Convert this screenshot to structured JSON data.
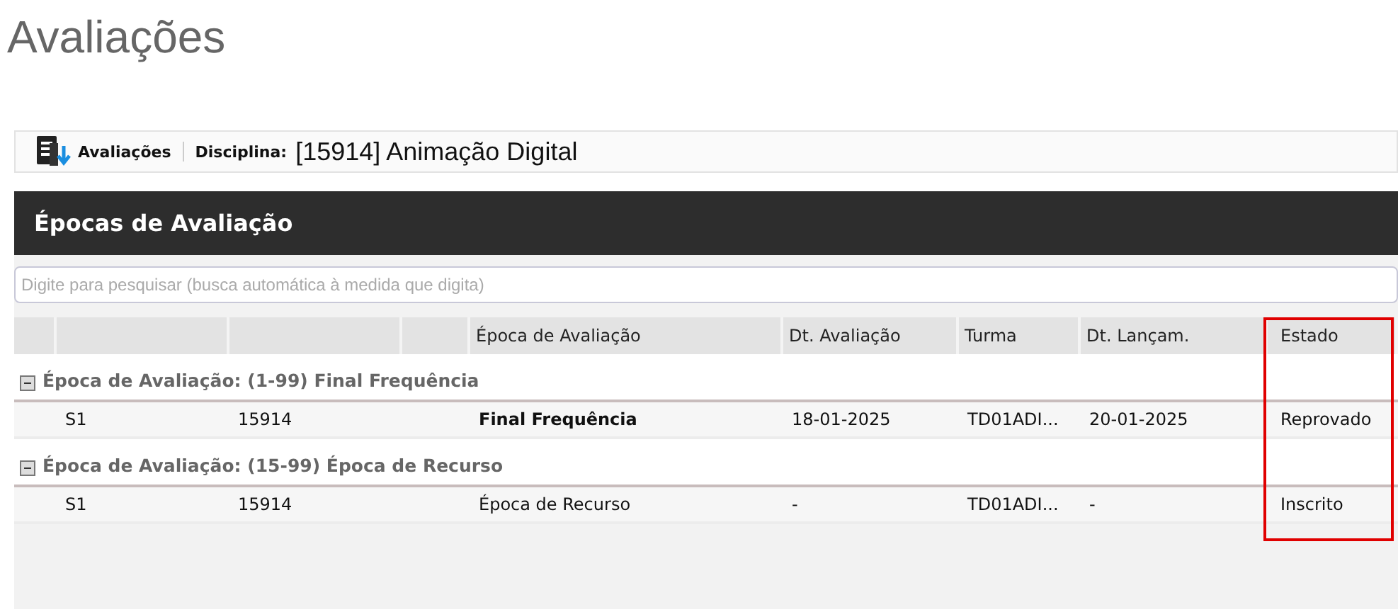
{
  "page_title": "Avaliações",
  "toolbar": {
    "button": "Avaliações",
    "label": "Disciplina:",
    "value": "[15914] Animação Digital"
  },
  "panel": {
    "title": "Épocas de Avaliação",
    "search": {
      "placeholder": "Digite para pesquisar (busca automática à medida que digita)"
    }
  },
  "table": {
    "columns": [
      "Época de Avaliação",
      "Dt. Avaliação",
      "Turma",
      "Dt. Lançam.",
      "Estado"
    ],
    "groups": [
      {
        "title": "Época de Avaliação: (1-99) Final Frequência",
        "expanded": true,
        "rows": [
          {
            "column_2": "S1",
            "column_3": "15914",
            "epoca": "Final Frequência",
            "emphasized": true,
            "dt_avaliacao": "18-01-2025",
            "turma": "TD01ADI...",
            "dt_lancamento": "20-01-2025",
            "estado": "Reprovado"
          }
        ]
      },
      {
        "title": "Época de Avaliação: (15-99) Época de Recurso",
        "expanded": true,
        "rows": [
          {
            "column_2": "S1",
            "column_3": "15914",
            "epoca": "Época de Recurso",
            "emphasized": false,
            "dt_avaliacao": "-",
            "turma": "TD01ADI...",
            "dt_lancamento": "-",
            "estado": "Inscrito"
          }
        ]
      }
    ]
  },
  "annotation": {
    "kind": "highlight-box",
    "color": "#e00000"
  }
}
